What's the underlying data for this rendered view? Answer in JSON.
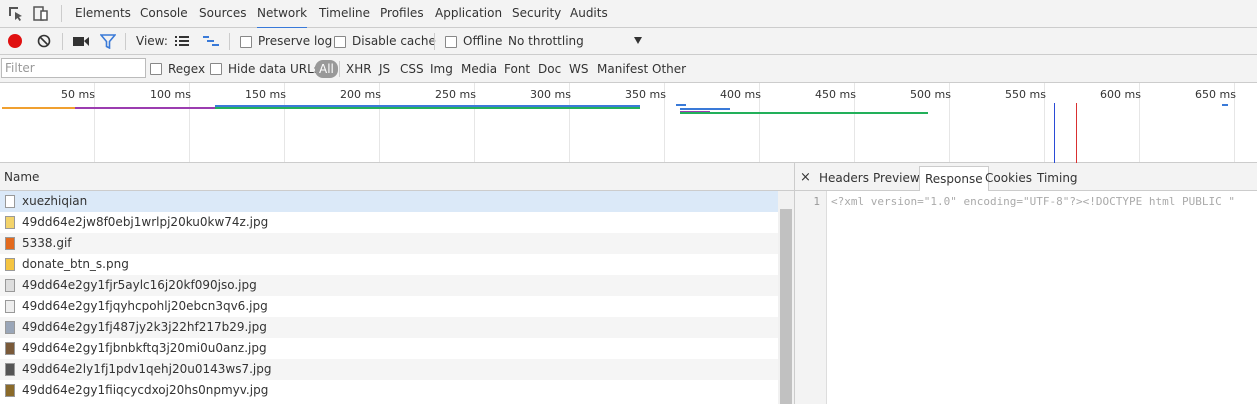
{
  "devtools": {
    "tabs": [
      "Elements",
      "Console",
      "Sources",
      "Network",
      "Timeline",
      "Profiles",
      "Application",
      "Security",
      "Audits"
    ],
    "selected_tab": "Network"
  },
  "toolbar": {
    "view_label": "View:",
    "preserve_log_label": "Preserve log",
    "disable_cache_label": "Disable cache",
    "offline_label": "Offline",
    "throttling_value": "No throttling"
  },
  "filter_bar": {
    "placeholder": "Filter",
    "regex_label": "Regex",
    "hide_data_urls_label": "Hide data URLs",
    "types": [
      "All",
      "XHR",
      "JS",
      "CSS",
      "Img",
      "Media",
      "Font",
      "Doc",
      "WS",
      "Manifest",
      "Other"
    ],
    "selected_type": "All"
  },
  "timeline": {
    "tick_labels": [
      "50 ms",
      "100 ms",
      "150 ms",
      "200 ms",
      "250 ms",
      "300 ms",
      "350 ms",
      "400 ms",
      "450 ms",
      "500 ms",
      "550 ms",
      "600 ms",
      "650 ms"
    ],
    "colors": {
      "orange": "#f0a030",
      "purple": "#9b3cb0",
      "green": "#22b05a",
      "blue": "#3a7ad8",
      "dom_content_loaded": "#2a4bd6",
      "load": "#d93030"
    }
  },
  "requests": {
    "column_name": "Name",
    "rows": [
      {
        "name": "xuezhiqian",
        "icon": "document-icon"
      },
      {
        "name": "49dd64e2jw8f0ebj1wrlpj20ku0kw74z.jpg",
        "icon": "image-thumbnail-icon"
      },
      {
        "name": "5338.gif",
        "icon": "gif-thumbnail-icon"
      },
      {
        "name": "donate_btn_s.png",
        "icon": "image-thumbnail-icon"
      },
      {
        "name": "49dd64e2gy1fjr5aylc16j20kf090jso.jpg",
        "icon": "image-thumbnail-icon"
      },
      {
        "name": "49dd64e2gy1fjqyhcpohlj20ebcn3qv6.jpg",
        "icon": "image-thumbnail-icon"
      },
      {
        "name": "49dd64e2gy1fj487jy2k3j22hf217b29.jpg",
        "icon": "image-thumbnail-icon"
      },
      {
        "name": "49dd64e2gy1fjbnbkftq3j20mi0u0anz.jpg",
        "icon": "image-thumbnail-icon"
      },
      {
        "name": "49dd64e2ly1fj1pdv1qehj20u0143ws7.jpg",
        "icon": "image-thumbnail-icon"
      },
      {
        "name": "49dd64e2gy1fiiqcycdxoj20hs0npmyv.jpg",
        "icon": "image-thumbnail-icon"
      }
    ]
  },
  "detail_panel": {
    "close_glyph": "×",
    "tabs": [
      "Headers",
      "Preview",
      "Response",
      "Cookies",
      "Timing"
    ],
    "selected_tab": "Response",
    "line_number": "1",
    "response_text": "<?xml version=\"1.0\" encoding=\"UTF-8\"?><!DOCTYPE html PUBLIC \""
  }
}
